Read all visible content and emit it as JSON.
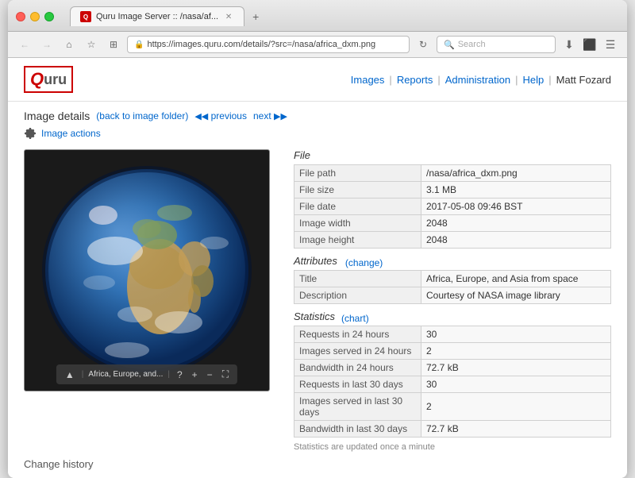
{
  "browser": {
    "tab_label": "Quru Image Server :: /nasa/af...",
    "url": "https://images.quru.com/details/?src=/nasa/africa_dxm.png",
    "search_placeholder": "Search",
    "new_tab_symbol": "+"
  },
  "app": {
    "logo_q": "Q",
    "logo_uru": "uru",
    "nav": {
      "images": "Images",
      "reports": "Reports",
      "administration": "Administration",
      "help": "Help",
      "user": "Matt Fozard"
    }
  },
  "page": {
    "title": "Image details",
    "back_link": "(back to image folder)",
    "prev_label": "previous",
    "next_label": "next",
    "image_actions_label": "Image actions"
  },
  "file_section": {
    "title": "File",
    "rows": [
      {
        "label": "File path",
        "value": "/nasa/africa_dxm.png"
      },
      {
        "label": "File size",
        "value": "3.1 MB"
      },
      {
        "label": "File date",
        "value": "2017-05-08 09:46 BST"
      },
      {
        "label": "Image width",
        "value": "2048"
      },
      {
        "label": "Image height",
        "value": "2048"
      }
    ]
  },
  "attributes_section": {
    "title": "Attributes",
    "change_label": "(change)",
    "rows": [
      {
        "label": "Title",
        "value": "Africa, Europe, and Asia from space"
      },
      {
        "label": "Description",
        "value": "Courtesy of NASA image library"
      }
    ]
  },
  "statistics_section": {
    "title": "Statistics",
    "chart_label": "(chart)",
    "rows": [
      {
        "label": "Requests in 24 hours",
        "value": "30"
      },
      {
        "label": "Images served in 24 hours",
        "value": "2"
      },
      {
        "label": "Bandwidth in 24 hours",
        "value": "72.7 kB"
      },
      {
        "label": "Requests in last 30 days",
        "value": "30"
      },
      {
        "label": "Images served in last 30 days",
        "value": "2"
      },
      {
        "label": "Bandwidth in last 30 days",
        "value": "72.7 kB"
      }
    ],
    "note": "Statistics are updated once a minute"
  },
  "image": {
    "caption": "Africa, Europe, and...",
    "alt": "Earth from space showing Africa, Europe and Asia"
  },
  "change_history": {
    "label": "Change history"
  }
}
